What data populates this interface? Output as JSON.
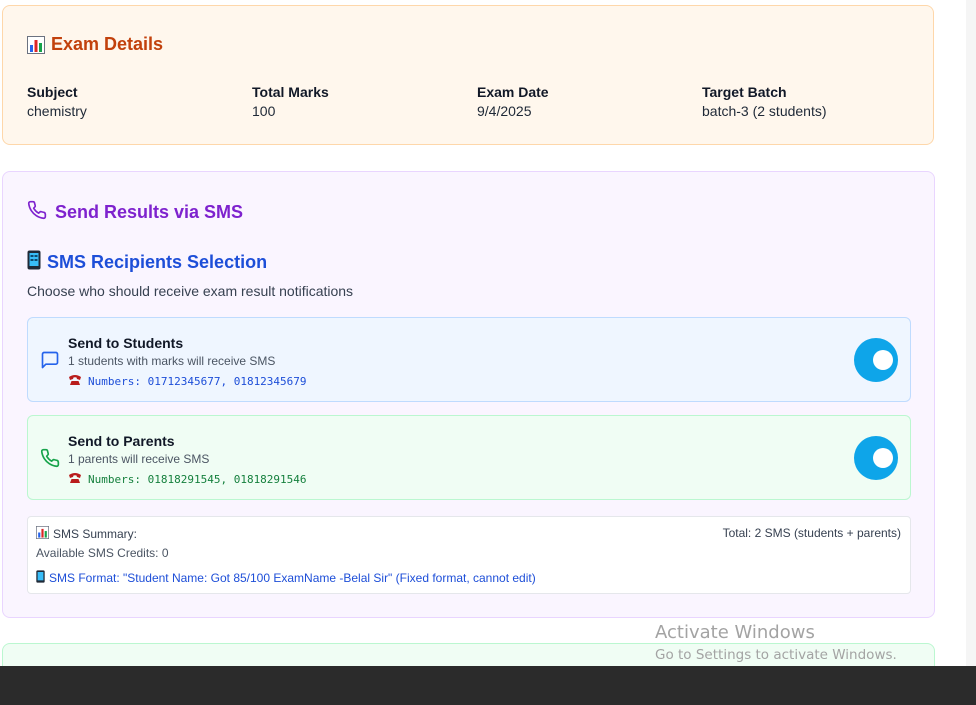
{
  "exam_details": {
    "title": "Exam Details",
    "title_icon": "bar-chart-icon",
    "fields": [
      {
        "label": "Subject",
        "value": "chemistry"
      },
      {
        "label": "Total Marks",
        "value": "100"
      },
      {
        "label": "Exam Date",
        "value": "9/4/2025"
      },
      {
        "label": "Target Batch",
        "value": "batch-3 (2 students)"
      }
    ]
  },
  "sms": {
    "title": "Send Results via SMS",
    "title_icon": "phone-icon",
    "selection_title": "SMS Recipients Selection",
    "selection_icon": "mobile-phone-icon",
    "selection_subtitle": "Choose who should receive exam result notifications",
    "students": {
      "title": "Send to Students",
      "description": "1 students with marks will receive SMS",
      "numbers": "Numbers: 01712345677, 01812345679",
      "icon": "message-icon",
      "enabled": true
    },
    "parents": {
      "title": "Send to Parents",
      "description": "1 parents will receive SMS",
      "numbers": "Numbers: 01818291545, 01818291546",
      "icon": "phone-icon",
      "enabled": true
    },
    "summary": {
      "heading": "SMS Summary:",
      "total": "Total: 2 SMS (students + parents)",
      "credits": "Available SMS Credits: 0",
      "format": "SMS Format: \"Student Name: Got 85/100 ExamName -Belal Sir\" (Fixed format, cannot edit)"
    }
  },
  "watermark": {
    "title": "Activate Windows",
    "subtitle": "Go to Settings to activate Windows."
  },
  "colors": {
    "exam_accent": "#c2410c",
    "sms_accent": "#7e22ce",
    "selection_accent": "#1d4ed8",
    "toggle_on": "#0ea5e9"
  }
}
